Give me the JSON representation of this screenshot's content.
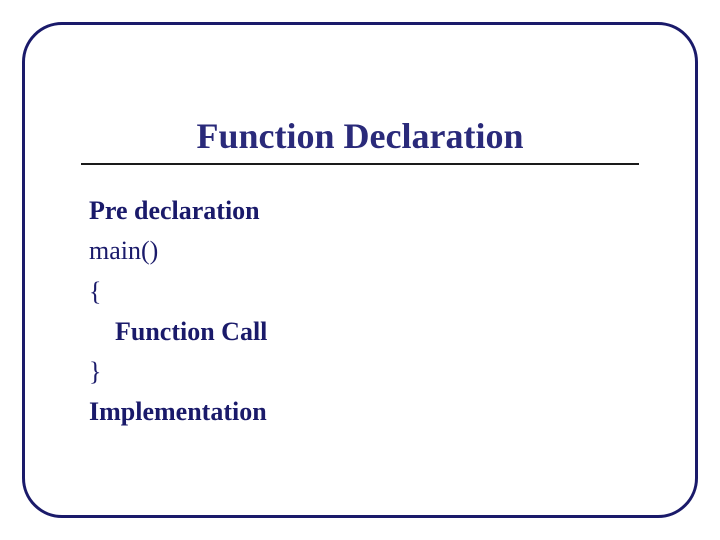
{
  "title": "Function Declaration",
  "lines": {
    "l1": "Pre declaration",
    "l2": "main()",
    "l3": "{",
    "l4": "Function Call",
    "l5": "}",
    "l6": "Implementation"
  }
}
